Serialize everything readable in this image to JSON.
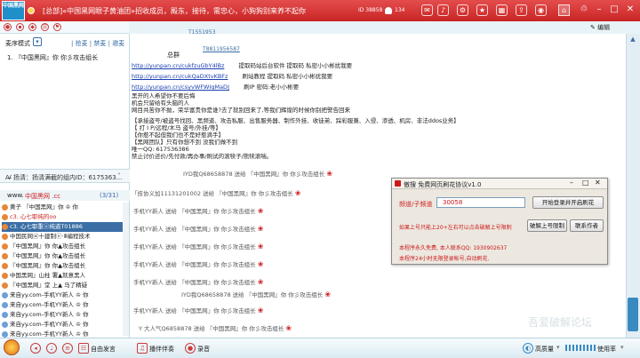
{
  "window": {
    "title": "[总部]«中国黑网眼子黄油团»招收成员，殿东，接待，需忠心，小狗狗别来养不起你",
    "room_id": "ID 38858",
    "users": "134",
    "logo_text": "中国黑网",
    "edit_label": "编辑"
  },
  "left": {
    "mic_mode": "麦序模式",
    "mic_menu": "| 抢麦 | 禁麦 | 邀麦",
    "mic_entry": "1. 『中国黑网』你   你彡攻击组长",
    "notice": "Ꜻ 扬清：扬清满截的组内ID：6175363...",
    "member_header_prefix": "www.",
    "member_header": "中国黑网 .cc",
    "member_count": "(3/31)",
    "members": [
      "黄子   『中国黑网』你  ♔ 你",
      "c3. 心七耶纯的oo",
      "c3. 心七耶重ⓤ纯道T01886",
      "中国民网ⓦ十建制ⓔ·ꗊ编程技术",
      "『中国黑网』你  你▲攻击组长",
      "『中国黑网』你  你▲攻击组长",
      "『中国黑网』你  你▲攻击组长",
      "中国黑网』山柱  署▲就意黑人",
      "『中国黑网』堂  上▲ 马了精疑",
      "来自yy.com-手机YY新人  ♔ 你",
      "来自yy.com-手机YY新人  ♔ 你",
      "来自yy.com-手机YY新人  ♔ 你",
      "来自yy.com-手机YY新人  ♔ 你",
      "来自yy.com-手机YY新人  ♔ 你",
      "来自yy.com-手机YY新人  ♔ 你"
    ]
  },
  "announcement": {
    "top_ids": [
      "T1551953",
      "T8811956587"
    ],
    "owner_label": "总群",
    "links": [
      {
        "url": "http://yunpan.cn/cukfzuGbY4lBz",
        "desc": "提取码站后台软件  提取码  私密小小彬扰我要"
      },
      {
        "url": "http://yunpan.cn/cukQaDXtvKBFz",
        "desc": "刷站教程  提取码  私密小小彬扰我要"
      },
      {
        "url": "http://yunpan.cn/csyvWFWIqMaDJ",
        "desc": "刷IP  密码:老小小彬要"
      }
    ],
    "lines": [
      "黑开的人希望你不要后悔",
      "机会只留给有头脑的人",
      "网目共苦你不抛，荣华富贵你是谁?去了就别回来了,等我们辉煌的时候你别把警告回来",
      "【承接盗号/被盗号找回、黑频道、攻击私服、出售服务器、制作外挂、收徒弟、踩彩服兼、入侵、渗透、机房、非法ddos业务】",
      "【  打 I P/远程/木马  盗号/外挂/等】",
      "【你惹不起但我们也不是好惹滴手】",
      "【黑网团队】只有你想不到  没我们做不到",
      "唯一QQ: 617536386",
      "禁止讨价还价/先付款/再办事/刷试的滚犊子/熊犊滚喘。"
    ]
  },
  "chat": [
    {
      "sender": "IYD我Q68658878",
      "msg": "送给   『中国黑网』你    你彡攻击组长"
    },
    {
      "sender": "「技协义加11131201002",
      "msg": "送给   『中国黑网』你    你彡攻击组长"
    },
    {
      "sender": "手机YY新人",
      "msg": "送给   『中国黑网』你    你彡攻击组长"
    },
    {
      "sender": "手机YY新人",
      "msg": "送给   『中国黑网』你    你彡攻击组长"
    },
    {
      "sender": "手机YY新人",
      "msg": "送给   『中国黑网』你    你彡攻击组长"
    },
    {
      "sender": "手机YY新人",
      "msg": "送给   『中国黑网』你    你彡攻击组长"
    },
    {
      "sender": "手机YY新人",
      "msg": "送给   『中国黑网』你    你彡攻击组长"
    },
    {
      "sender": "IYD我Q68658878",
      "msg": "送给   『中国黑网』你    你彡攻击组长"
    },
    {
      "sender": "手机YY新人",
      "msg": "送给   『中国黑网』你    你彡攻击组长"
    },
    {
      "sender": "Y  大人气Q6858878",
      "msg": "送给   『中国黑网』你    你彡攻击组长"
    }
  ],
  "dialog": {
    "title": "傲搜 免费网页刷花协议v1.0",
    "field_label": "频道/子频道",
    "field_value": "30058",
    "start_button": "开始登录并开启刷花",
    "warning": "如果上号只能上20+左右可以点击破解上号限制",
    "free_note": "本程序永久免费, 本人联系QQ: 1930902637",
    "auto_note": "本程序24小时无限登录帐号,自动刷花.",
    "crack_button": "破解上号限制",
    "contact_button": "联系作者"
  },
  "bottom": {
    "free_chat": "自由发言",
    "play_accompany": "播伴伴奏",
    "record": "录音",
    "voice_quality": "高质量",
    "watermark": "吾爱破解论坛",
    "right_label": "使用率"
  },
  "colors": {
    "titlebar": "#d8383a",
    "accent_blue": "#3a6ea5",
    "warning_red": "#cc1a1a"
  }
}
